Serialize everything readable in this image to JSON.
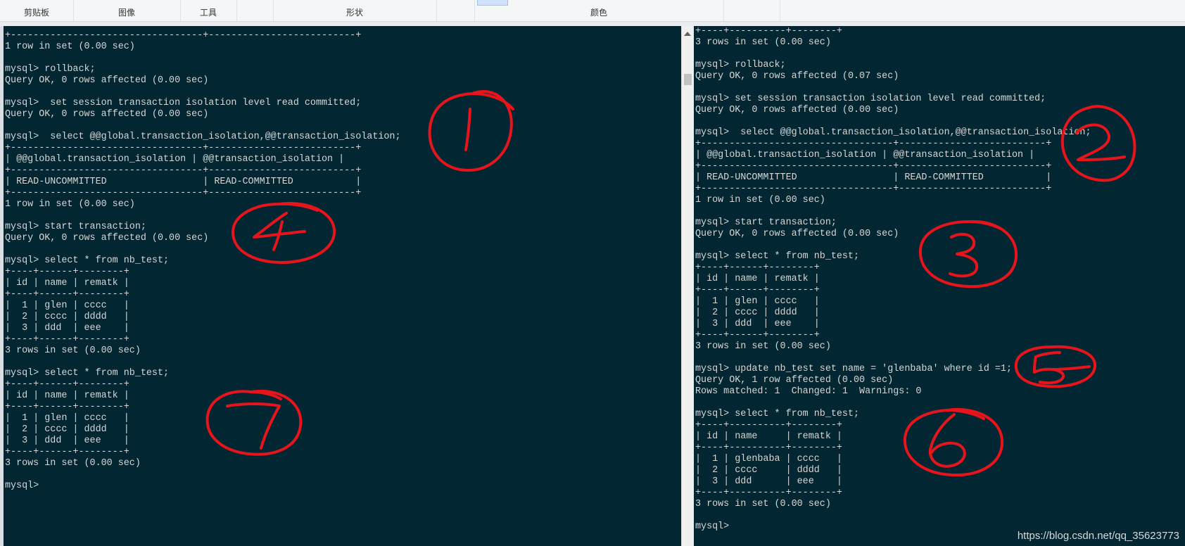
{
  "ribbon": {
    "clipboard": "剪贴板",
    "image": "图像",
    "tools": "工具",
    "shapes": "形状",
    "colors": "颜色"
  },
  "left_terminal": {
    "text": "+----------------------------------+--------------------------+\n1 row in set (0.00 sec)\n\nmysql> rollback;\nQuery OK, 0 rows affected (0.00 sec)\n\nmysql>  set session transaction isolation level read committed;\nQuery OK, 0 rows affected (0.00 sec)\n\nmysql>  select @@global.transaction_isolation,@@transaction_isolation;\n+----------------------------------+--------------------------+\n| @@global.transaction_isolation | @@transaction_isolation |\n+----------------------------------+--------------------------+\n| READ-UNCOMMITTED                 | READ-COMMITTED           |\n+----------------------------------+--------------------------+\n1 row in set (0.00 sec)\n\nmysql> start transaction;\nQuery OK, 0 rows affected (0.00 sec)\n\nmysql> select * from nb_test;\n+----+------+--------+\n| id | name | rematk |\n+----+------+--------+\n|  1 | glen | cccc   |\n|  2 | cccc | dddd   |\n|  3 | ddd  | eee    |\n+----+------+--------+\n3 rows in set (0.00 sec)\n\nmysql> select * from nb_test;\n+----+------+--------+\n| id | name | rematk |\n+----+------+--------+\n|  1 | glen | cccc   |\n|  2 | cccc | dddd   |\n|  3 | ddd  | eee    |\n+----+------+--------+\n3 rows in set (0.00 sec)\n\nmysql>"
  },
  "right_terminal": {
    "text": "+----+----------+--------+\n3 rows in set (0.00 sec)\n\nmysql> rollback;\nQuery OK, 0 rows affected (0.07 sec)\n\nmysql> set session transaction isolation level read committed;\nQuery OK, 0 rows affected (0.00 sec)\n\nmysql>  select @@global.transaction_isolation,@@transaction_isolation;\n+----------------------------------+--------------------------+\n| @@global.transaction_isolation | @@transaction_isolation |\n+----------------------------------+--------------------------+\n| READ-UNCOMMITTED                 | READ-COMMITTED           |\n+----------------------------------+--------------------------+\n1 row in set (0.00 sec)\n\nmysql> start transaction;\nQuery OK, 0 rows affected (0.00 sec)\n\nmysql> select * from nb_test;\n+----+------+--------+\n| id | name | rematk |\n+----+------+--------+\n|  1 | glen | cccc   |\n|  2 | cccc | dddd   |\n|  3 | ddd  | eee    |\n+----+------+--------+\n3 rows in set (0.00 sec)\n\nmysql> update nb_test set name = 'glenbaba' where id =1;\nQuery OK, 1 row affected (0.00 sec)\nRows matched: 1  Changed: 1  Warnings: 0\n\nmysql> select * from nb_test;\n+----+----------+--------+\n| id | name     | rematk |\n+----+----------+--------+\n|  1 | glenbaba | cccc   |\n|  2 | cccc     | dddd   |\n|  3 | ddd      | eee    |\n+----+----------+--------+\n3 rows in set (0.00 sec)\n\nmysql>"
  },
  "annotations": {
    "color": "#e8141c",
    "labels": [
      "1",
      "2",
      "3",
      "4",
      "5",
      "6",
      "7"
    ]
  },
  "watermark": "https://blog.csdn.net/qq_35623773",
  "colors": {
    "terminal_bg": "#022732",
    "terminal_text": "#d6d6d6"
  }
}
